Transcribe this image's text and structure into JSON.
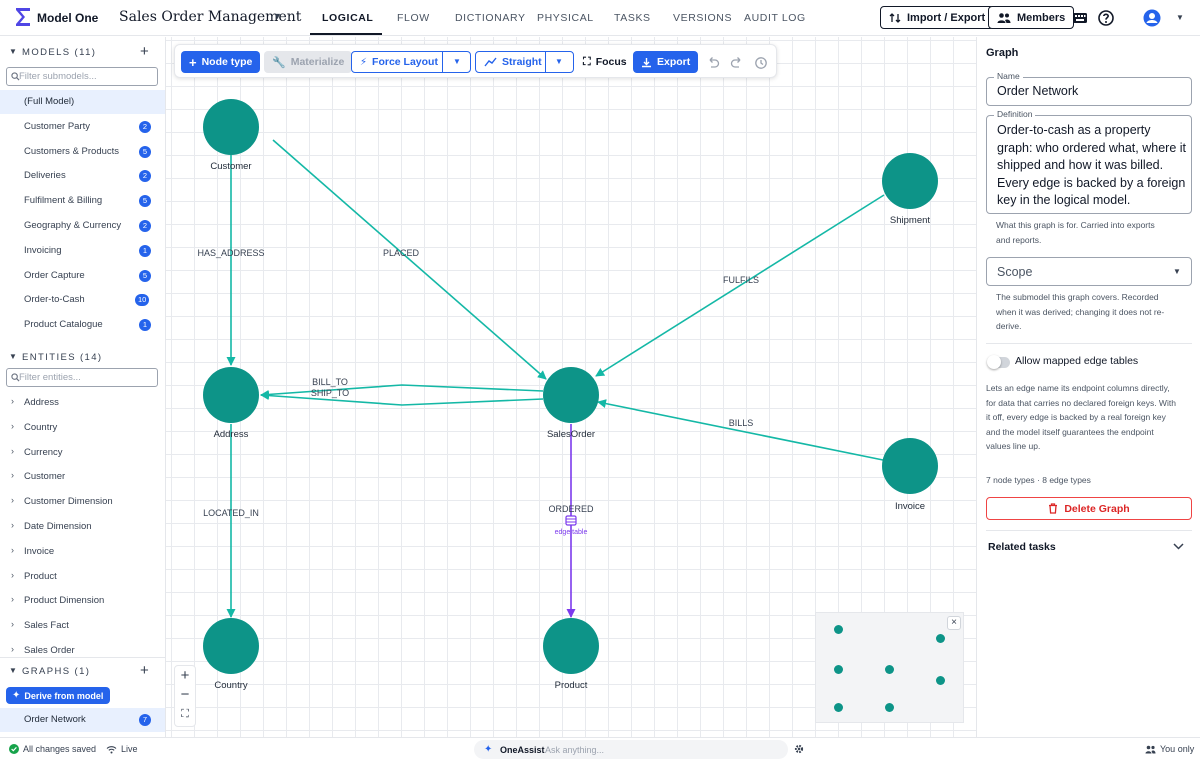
{
  "app": {
    "name": "Model One",
    "doc_title": "Sales Order Management"
  },
  "nav": {
    "tabs": [
      "LOGICAL",
      "FLOW",
      "DICTIONARY",
      "PHYSICAL",
      "TASKS",
      "VERSIONS",
      "AUDIT LOG"
    ],
    "active": "LOGICAL"
  },
  "header": {
    "import_export": "Import / Export",
    "members": "Members"
  },
  "sidebar": {
    "models_label": "MODELS (11)",
    "models_filter_placeholder": "Filter submodels...",
    "models": [
      {
        "label": "(Full Model)",
        "count": "",
        "selected": true
      },
      {
        "label": "Customer Party",
        "count": "2"
      },
      {
        "label": "Customers & Products",
        "count": "5"
      },
      {
        "label": "Deliveries",
        "count": "2"
      },
      {
        "label": "Fulfilment & Billing",
        "count": "5"
      },
      {
        "label": "Geography & Currency",
        "count": "2"
      },
      {
        "label": "Invoicing",
        "count": "1"
      },
      {
        "label": "Order Capture",
        "count": "5"
      },
      {
        "label": "Order-to-Cash",
        "count": "10"
      },
      {
        "label": "Product Catalogue",
        "count": "1"
      }
    ],
    "entities_label": "ENTITIES (14)",
    "entities_filter_placeholder": "Filter entities...",
    "entities": [
      "Address",
      "Country",
      "Currency",
      "Customer",
      "Customer Dimension",
      "Date Dimension",
      "Invoice",
      "Product",
      "Product Dimension",
      "Sales Fact",
      "Sales Order"
    ],
    "graphs_label": "GRAPHS (1)",
    "derive_label": "Derive from model",
    "graphs": [
      {
        "label": "Order Network",
        "count": "7",
        "selected": true
      }
    ]
  },
  "toolbar": {
    "node_type": "Node type",
    "materialize": "Materialize",
    "force_layout": "Force Layout",
    "straight": "Straight",
    "focus": "Focus",
    "export": "Export"
  },
  "graph": {
    "nodes": [
      {
        "id": "customer",
        "label": "Customer"
      },
      {
        "id": "shipment",
        "label": "Shipment"
      },
      {
        "id": "address",
        "label": "Address"
      },
      {
        "id": "salesorder",
        "label": "SalesOrder"
      },
      {
        "id": "invoice",
        "label": "Invoice"
      },
      {
        "id": "country",
        "label": "Country"
      },
      {
        "id": "product",
        "label": "Product"
      }
    ],
    "edges": [
      {
        "label": "HAS_ADDRESS"
      },
      {
        "label": "PLACED"
      },
      {
        "label": "FULFILS"
      },
      {
        "label": "BILL_TO"
      },
      {
        "label": "SHIP_TO"
      },
      {
        "label": "BILLS"
      },
      {
        "label": "LOCATED_IN"
      },
      {
        "label": "ORDERED",
        "sub": "edge table"
      }
    ],
    "colors": {
      "node": "#0d9488",
      "edge": "#14b8a6",
      "edge_table": "#7c3aed",
      "accent": "#2563eb"
    }
  },
  "panel": {
    "title": "Graph",
    "name_label": "Name",
    "name_value": "Order Network",
    "definition_label": "Definition",
    "definition_lines": [
      "Order-to-cash as a property",
      "graph: who ordered what, where it",
      "shipped and how it was billed.",
      "Every edge is backed by a foreign",
      "key in the logical model."
    ],
    "definition_help_lines": [
      "What this graph is for. Carried into exports",
      "and reports."
    ],
    "scope_placeholder": "Scope",
    "scope_help_lines": [
      "The submodel this graph covers. Recorded",
      "when it was derived; changing it does not re-",
      "derive."
    ],
    "toggle_label": "Allow mapped edge tables",
    "toggle_help_lines": [
      "Lets an edge name its endpoint columns directly,",
      "for data that carries no declared foreign keys. With",
      "it off, every edge is backed by a real foreign key",
      "and the model itself guarantees the endpoint",
      "values line up."
    ],
    "summary": "7 node types · 8 edge types",
    "delete_label": "Delete Graph",
    "related_tasks": "Related tasks"
  },
  "status": {
    "saved": "All changes saved",
    "live": "Live",
    "assist_name": "OneAssist",
    "assist_placeholder": "Ask anything...",
    "visibility": "You only"
  }
}
